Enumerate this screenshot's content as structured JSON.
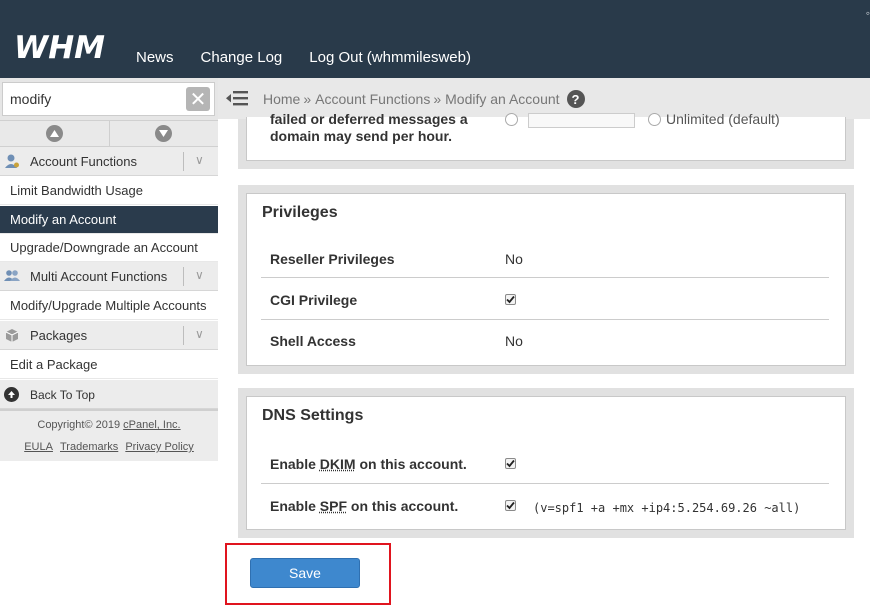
{
  "header": {
    "logo": "WHM",
    "nav": [
      "News",
      "Change Log",
      "Log Out (whmmilesweb)"
    ]
  },
  "sidebar": {
    "search": {
      "value": "modify",
      "placeholder": ""
    },
    "categories": [
      {
        "label": "Account Functions",
        "icon": "user-icon",
        "items": [
          {
            "label": "Limit Bandwidth Usage",
            "active": false
          },
          {
            "label": "Modify an Account",
            "active": true
          },
          {
            "label": "Upgrade/Downgrade an Account",
            "active": false
          }
        ]
      },
      {
        "label": "Multi Account Functions",
        "icon": "users-icon",
        "items": [
          {
            "label": "Modify/Upgrade Multiple Accounts",
            "active": false
          }
        ]
      },
      {
        "label": "Packages",
        "icon": "package-icon",
        "items": [
          {
            "label": "Edit a Package",
            "active": false
          }
        ]
      }
    ],
    "back_to_top": "Back To Top",
    "copyright_prefix": "Copyright© 2019 ",
    "copyright_link": "cPanel, Inc.",
    "footer_links": [
      "EULA",
      "Trademarks",
      "Privacy Policy"
    ]
  },
  "breadcrumb": {
    "items": [
      "Home",
      "Account Functions",
      "Modify an Account"
    ],
    "separator": "»"
  },
  "main": {
    "previous_row": {
      "label": "failed or deferred messages a domain may send per hour.",
      "option_unlimited": "Unlimited (default)"
    },
    "privileges": {
      "title": "Privileges",
      "rows": [
        {
          "label": "Reseller Privileges",
          "value": "No",
          "type": "text"
        },
        {
          "label": "CGI Privilege",
          "value": "",
          "type": "checkbox",
          "checked": true
        },
        {
          "label": "Shell Access",
          "value": "No",
          "type": "text"
        }
      ]
    },
    "dns": {
      "title": "DNS Settings",
      "dkim": {
        "prefix": "Enable ",
        "abbr": "DKIM",
        "suffix": " on this account.",
        "checked": true
      },
      "spf": {
        "prefix": "Enable ",
        "abbr": "SPF",
        "suffix": " on this account.",
        "checked": true,
        "record": "(v=spf1 +a +mx +ip4:5.254.69.26 ~all)"
      }
    },
    "save_label": "Save"
  },
  "colors": {
    "header_bg": "#293a4a",
    "active_item_bg": "#2a3b4c",
    "save_button": "#3e88ce",
    "highlight_border": "#e0141e"
  }
}
